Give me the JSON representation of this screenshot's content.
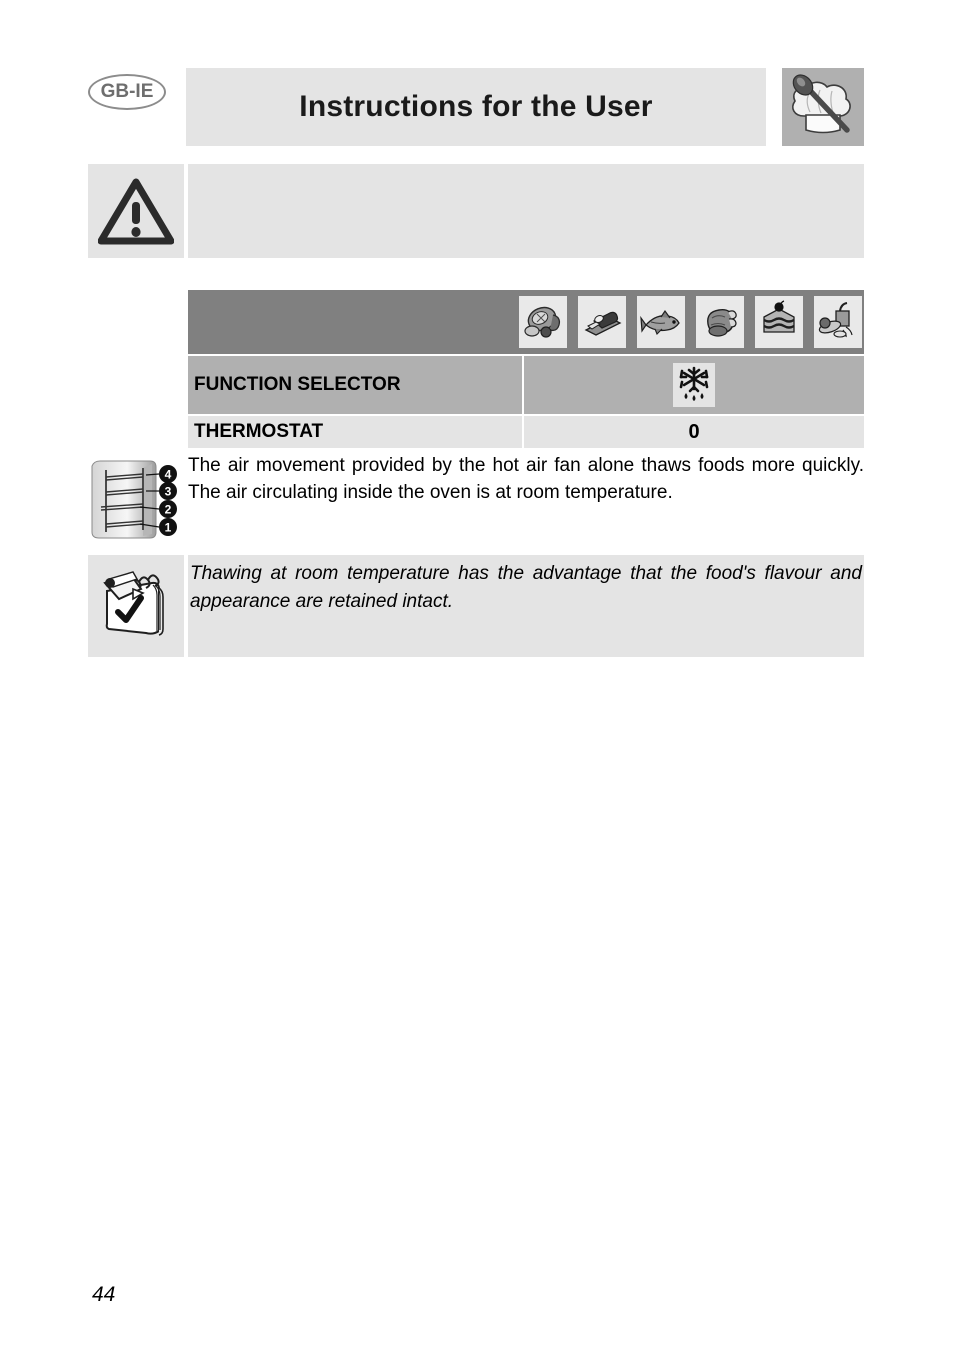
{
  "header": {
    "language_badge": "GB-IE",
    "title": "Instructions for the User",
    "chef_icon": "chef-hat-spoon-icon"
  },
  "warning": {
    "icon": "warning-triangle-icon",
    "text": ""
  },
  "function_table": {
    "food_icons": [
      {
        "name": "meat-ham-icon",
        "label": "Meat"
      },
      {
        "name": "bread-toast-icon",
        "label": "Bread"
      },
      {
        "name": "fish-icon",
        "label": "Fish"
      },
      {
        "name": "poultry-chicken-icon",
        "label": "Poultry"
      },
      {
        "name": "cake-slice-icon",
        "label": "Cake"
      },
      {
        "name": "vegetables-icon",
        "label": "Vegetables"
      }
    ],
    "rows": [
      {
        "label": "FUNCTION SELECTOR",
        "value": "",
        "value_icon": "defrost-snowflake-drops-icon"
      },
      {
        "label": "THERMOSTAT",
        "value": "0",
        "value_icon": ""
      }
    ]
  },
  "body": {
    "rack_icon": "oven-shelf-levels-icon",
    "rack_levels": [
      "4",
      "3",
      "2",
      "1"
    ],
    "paragraph": "The air movement provided by the hot air fan alone thaws foods more quickly. The air circulating inside the oven is at room temperature."
  },
  "note": {
    "icon": "notepad-pen-check-icon",
    "text": "Thawing at room temperature has the advantage that the food's flavour and appearance are retained intact."
  },
  "footer": {
    "page_number": "44"
  },
  "colors": {
    "header_bar": "#e4e4e4",
    "table_header": "#808080",
    "row_selector": "#b0b0b0",
    "row_thermostat": "#e4e4e4",
    "chef_box": "#b0b0b0",
    "badge_outline": "#8c8c8c"
  }
}
